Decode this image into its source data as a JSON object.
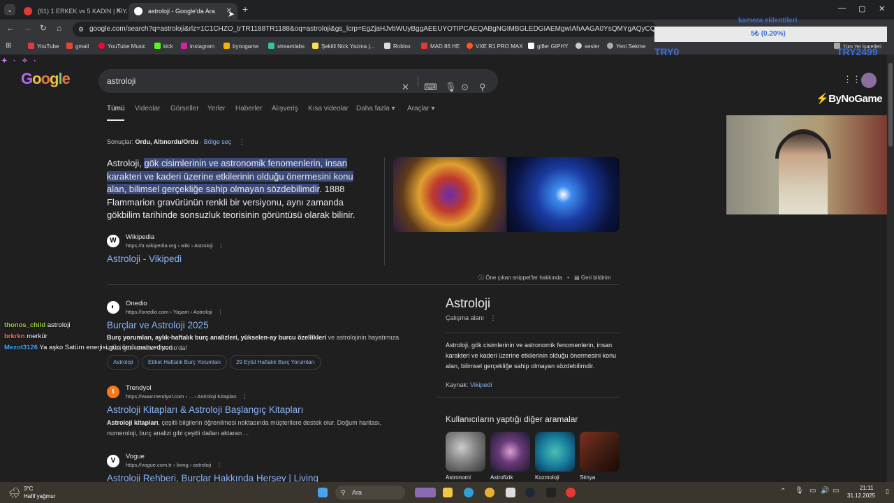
{
  "tabs": [
    {
      "title": "(61) 1 ERKEK vs 5 KADIN | KIYAF"
    },
    {
      "title": "astroloji - Google'da Ara"
    }
  ],
  "address": "google.com/search?q=astroloji&rlz=1C1CHZO_trTR1188TR1188&oq=astroloji&gs_lcrp=EgZjaHJvbWUyBggAEEUYOTIPCAEQABgNGIMBGLEDGIAEMgwIAhAAGA0YsQMYgAQyCQgDEAAYDRiABDIJ",
  "bookmarks": [
    "YouTube",
    "gmail",
    "YouTube Music",
    "kick",
    "instagram",
    "bynogame",
    "streamlabs",
    "Şekilli Nick Yazma |...",
    "Roblox",
    "MAD 86 HE",
    "VXE R1 PRO MAX",
    "gifler GIPHY",
    "sesler",
    "Yeni Sekme"
  ],
  "bookmarks_right": "Tüm Yer İşaretleri",
  "overlay": {
    "donation_title": "kamera eklentileri",
    "donation_progress": "5₺ (0.20%)",
    "try_left": "TRY0",
    "try_right": "TRY2499",
    "brand": "ByNoGame"
  },
  "search": {
    "query": "astroloji",
    "tabs": [
      "Tümü",
      "Videolar",
      "Görseller",
      "Yerler",
      "Haberler",
      "Alışveriş",
      "Kısa videolar",
      "Daha fazla",
      "Araçlar"
    ]
  },
  "location": {
    "label": "Sonuçlar:",
    "value": "Ordu, Altınordu/Ordu",
    "link": "Bölge seç"
  },
  "snippet": {
    "lead": "Astroloji, ",
    "highlight": "gök cisimlerinin ve astronomik fenomenlerin, insan karakteri ve kaderi üzerine etkilerinin olduğu önermesini konu alan, bilimsel gerçekliğe sahip olmayan sözdebilimdir",
    "rest": ". 1888 Flammarion gravürünün renkli bir versiyonu, aynı zamanda gökbilim tarihinde sonsuzluk teorisinin görüntüsü olarak bilinir.",
    "source_name": "Wikipedia",
    "source_url": "https://tr.wikipedia.org › wiki › Astroloji",
    "title": "Astroloji - Vikipedi",
    "about": "Öne çıkan snippet'ler hakkında",
    "feedback": "Geri bildirim"
  },
  "results": [
    {
      "source_name": "Onedio",
      "source_url": "https://onedio.com › Yaşam › Astroloji",
      "title": "Burçlar ve Astroloji 2025",
      "desc_bold": "Burç yorumları, aylık-haftalık burç analizleri, yükselen-ay burcu özellikleri",
      "desc": " ve astrolojinin hayatımıza",
      "desc2": "etkisi gibi konular Onedio'da!",
      "chips": [
        "Astroloji",
        "Etiket Haftalık Burç Yorumları",
        "29 Eylül Haftalık Burç Yorumları"
      ]
    },
    {
      "source_name": "Trendyol",
      "source_url": "https://www.trendyol.com › ... › Astroloji Kitapları",
      "title": "Astroloji Kitapları & Astroloji Başlangıç Kitapları",
      "desc_bold": "Astroloji kitapları",
      "desc": ", çeşitli bilgilerin öğrenilmesi noktasında müşterilere destek olur. Doğum haritası,",
      "desc2": "numeroloji, burç analizi gibi çeşitli dalları aktaran ..."
    },
    {
      "source_name": "Vogue",
      "source_url": "https://vogue.com.tr › living › astroloji",
      "title": "Astroloji Rehberi, Burçlar Hakkında Herşey | Living"
    }
  ],
  "knowledge_panel": {
    "title": "Astroloji",
    "subtitle": "Çalışma alanı",
    "description": "Astroloji, gök cisimlerinin ve astronomik fenomenlerin, insan karakteri ve kaderi üzerine etkilerinin olduğu önermesini konu alan, bilimsel gerçekliğe sahip olmayan sözdebilimdir.",
    "source_label": "Kaynak:",
    "source_link": "Vikipedi",
    "related_title": "Kullanıcıların yaptığı diğer aramalar",
    "related": [
      "Astronomi",
      "Astrofizik",
      "Kozmoloji",
      "Simya"
    ]
  },
  "chat": [
    {
      "user": "thonos_child",
      "msg": "astroloji",
      "color": "#9acd32"
    },
    {
      "user": "brkrkn",
      "msg": "merkür",
      "color": "#ff6b6b"
    },
    {
      "user": "Mezot3126",
      "msg": "Ya aşko Satürn enerjisi gün ömü mahvediyor",
      "color": "#4aa3ff"
    }
  ],
  "taskbar": {
    "weather_temp": "3°C",
    "weather_desc": "Hafif yağmur",
    "search": "Ara",
    "time": "21:11",
    "date": "31.12.2025"
  }
}
